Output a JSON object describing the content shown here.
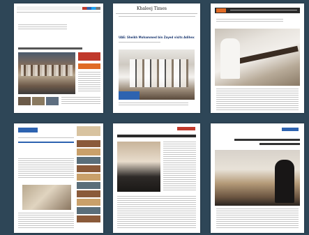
{
  "background": "#2e4657",
  "clippings": [
    {
      "id": "web-article-1",
      "headline": "",
      "caption": ""
    },
    {
      "id": "khaleej-times",
      "masthead": "Khaleej Times",
      "headline": "UAE: Sheikh Mohammed bin Zayed visits Adihex 2021",
      "caption": ""
    },
    {
      "id": "web-article-3",
      "headline": "",
      "caption": ""
    },
    {
      "id": "web-article-4",
      "headline": "",
      "caption": ""
    },
    {
      "id": "arabic-paper-5",
      "headline": "",
      "caption": ""
    },
    {
      "id": "arabic-web-6",
      "logo": "",
      "headline": "",
      "caption": ""
    }
  ],
  "colors": {
    "red": "#c0392b",
    "orange": "#e06b26",
    "blue": "#2d63b0",
    "navy": "#1f3b73"
  }
}
